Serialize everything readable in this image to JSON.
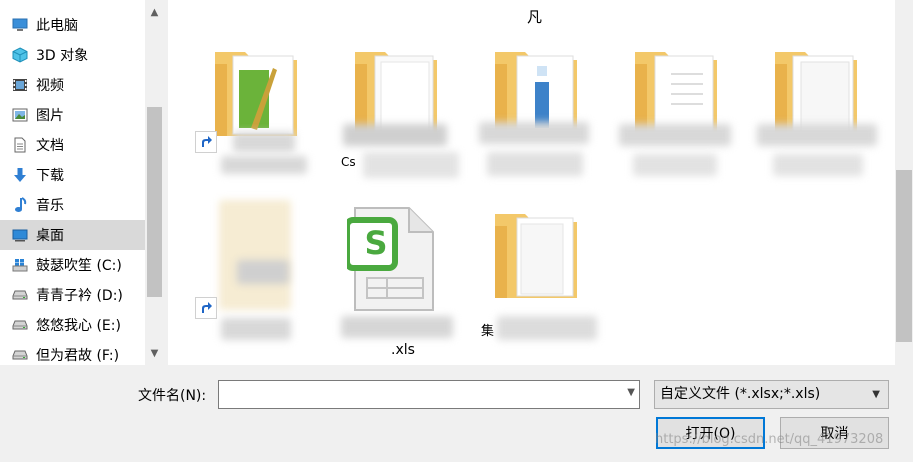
{
  "nav": {
    "items": [
      {
        "label": "此电脑",
        "icon": "computer-icon"
      },
      {
        "label": "3D 对象",
        "icon": "cube-3d-icon"
      },
      {
        "label": "视频",
        "icon": "film-icon"
      },
      {
        "label": "图片",
        "icon": "picture-icon"
      },
      {
        "label": "文档",
        "icon": "document-icon"
      },
      {
        "label": "下载",
        "icon": "download-arrow-icon"
      },
      {
        "label": "音乐",
        "icon": "music-note-icon"
      },
      {
        "label": "桌面",
        "icon": "desktop-icon",
        "selected": true
      },
      {
        "label": "鼓瑟吹笙 (C:)",
        "icon": "system-drive-icon"
      },
      {
        "label": "青青子衿 (D:)",
        "icon": "drive-icon"
      },
      {
        "label": "悠悠我心 (E:)",
        "icon": "drive-icon"
      },
      {
        "label": "但为君故 (F:)",
        "icon": "drive-icon"
      }
    ]
  },
  "files": {
    "header_char": "凡",
    "row1": [
      {
        "type": "folder-shortcut",
        "label_fragment": ""
      },
      {
        "type": "folder",
        "label_fragment": "Cs"
      },
      {
        "type": "folder",
        "label_fragment": ""
      },
      {
        "type": "folder",
        "label_fragment": ""
      },
      {
        "type": "folder",
        "label_fragment": ""
      }
    ],
    "row2": [
      {
        "type": "shortcut",
        "label_fragment": ""
      },
      {
        "type": "spreadsheet",
        "label_fragment": ".xls",
        "app_letter": "S"
      },
      {
        "type": "folder",
        "label_fragment": "集"
      }
    ]
  },
  "bottom": {
    "filename_label": "文件名(N):",
    "filename_value": "",
    "filter_value": "自定义文件 (*.xlsx;*.xls)",
    "open_label": "打开(O)",
    "cancel_label": "取消"
  },
  "watermark": "https://blog.csdn.net/qq_41973208"
}
